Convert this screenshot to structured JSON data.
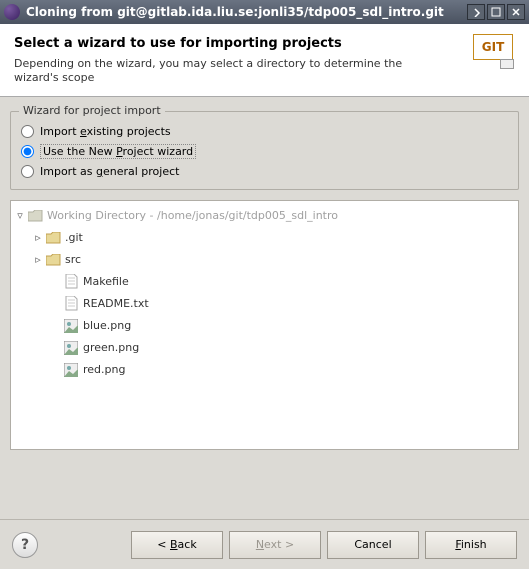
{
  "titlebar": {
    "title": "Cloning from git@gitlab.ida.liu.se:jonli35/tdp005_sdl_intro.git"
  },
  "header": {
    "title": "Select a wizard to use for importing projects",
    "description": "Depending on the wizard, you may select a directory to determine the wizard's scope",
    "logo_text": "GIT"
  },
  "group": {
    "title": "Wizard for project import",
    "options": {
      "existing_pre": "Import ",
      "existing_u": "e",
      "existing_post": "xisting projects",
      "newproj_pre": "Use the New ",
      "newproj_u": "P",
      "newproj_post": "roject wizard",
      "general_pre": "Import as ",
      "general_u": "g",
      "general_post": "eneral project"
    }
  },
  "tree": {
    "root": "Working Directory - /home/jonas/git/tdp005_sdl_intro",
    "items": [
      {
        "name": ".git",
        "type": "folder",
        "expandable": true
      },
      {
        "name": "src",
        "type": "folder",
        "expandable": true
      },
      {
        "name": "Makefile",
        "type": "file",
        "expandable": false
      },
      {
        "name": "README.txt",
        "type": "file",
        "expandable": false
      },
      {
        "name": "blue.png",
        "type": "image",
        "expandable": false
      },
      {
        "name": "green.png",
        "type": "image",
        "expandable": false
      },
      {
        "name": "red.png",
        "type": "image",
        "expandable": false
      }
    ]
  },
  "footer": {
    "help": "?",
    "back_pre": "< ",
    "back_u": "B",
    "back_post": "ack",
    "next_u": "N",
    "next_post": "ext >",
    "cancel": "Cancel",
    "finish_u": "F",
    "finish_post": "inish"
  }
}
